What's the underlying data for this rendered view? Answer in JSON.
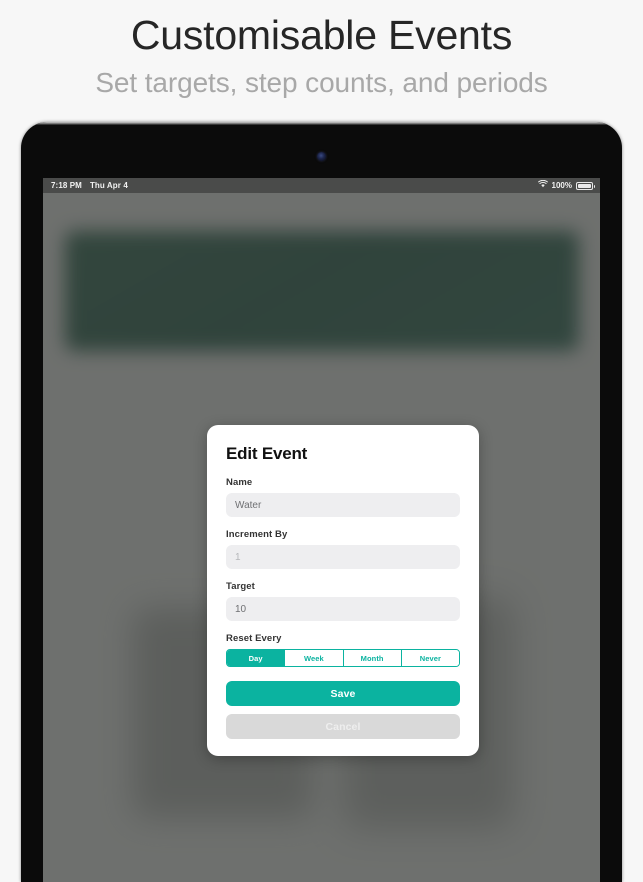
{
  "promo": {
    "title": "Customisable Events",
    "subtitle": "Set targets, step counts, and periods"
  },
  "status_bar": {
    "time": "7:18 PM",
    "date": "Thu Apr 4",
    "wifi_icon": "wifi-icon",
    "battery_percent": "100%",
    "battery_icon": "battery-full-icon"
  },
  "device": {
    "camera_icon": "front-camera-icon"
  },
  "modal": {
    "title": "Edit Event",
    "fields": [
      {
        "label": "Name",
        "value": "Water",
        "faint": false
      },
      {
        "label": "Increment By",
        "value": "1",
        "faint": true
      },
      {
        "label": "Target",
        "value": "10",
        "faint": false
      }
    ],
    "reset_every": {
      "label": "Reset Every",
      "options": [
        "Day",
        "Week",
        "Month",
        "Never"
      ],
      "selected": "Day"
    },
    "save_label": "Save",
    "cancel_label": "Cancel"
  },
  "colors": {
    "accent_teal": "#0bb3a0",
    "field_bg": "#eeeef0",
    "cancel_bg": "#d9d9d9",
    "card_green": "#14513d",
    "status_bar_bg": "#4a4b4a"
  }
}
